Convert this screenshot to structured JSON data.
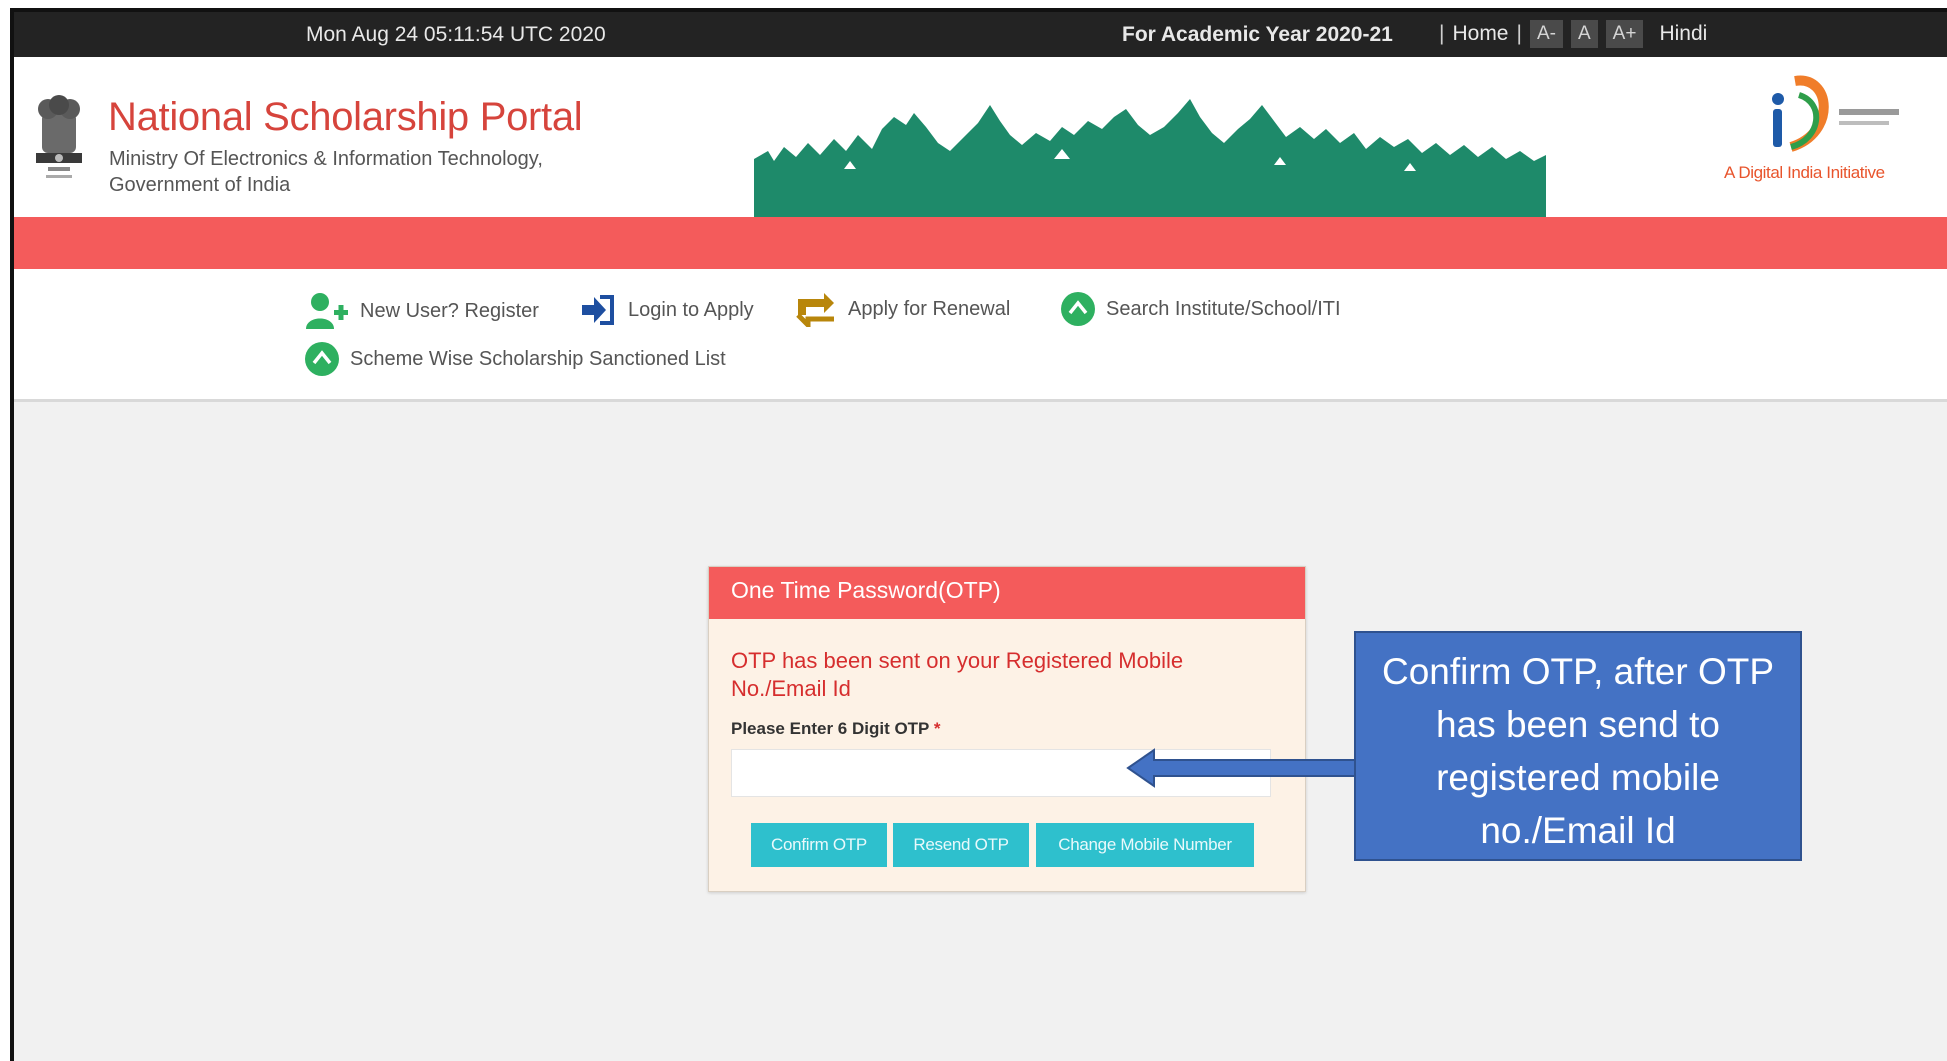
{
  "topbar": {
    "datetime": "Mon Aug 24 05:11:54 UTC 2020",
    "academic_year": "For Academic Year 2020-21",
    "sep": "|",
    "home": "Home",
    "font_small": "A-",
    "font_normal": "A",
    "font_large": "A+",
    "hindi": "Hindi"
  },
  "header": {
    "title": "National Scholarship Portal",
    "ministry": "Ministry Of Electronics & Information Technology,",
    "government": "Government of India",
    "digital_india_tagline": "A Digital India Initiative"
  },
  "nav": {
    "register": "New User? Register",
    "login": "Login to Apply",
    "renewal": "Apply for Renewal",
    "search": "Search Institute/School/ITI",
    "scheme_list": "Scheme Wise Scholarship Sanctioned List"
  },
  "otp_card": {
    "title": "One Time Password(OTP)",
    "message": "OTP has been sent on your Registered Mobile No./Email Id",
    "label": "Please Enter 6 Digit OTP",
    "required_mark": "*",
    "input_value": "",
    "confirm_label": "Confirm OTP",
    "resend_label": "Resend OTP",
    "change_label": "Change Mobile Number"
  },
  "annotation": {
    "line1": "Confirm OTP, after OTP",
    "line2": "has been send to",
    "line3": "registered mobile",
    "line4": "no./Email Id"
  },
  "colors": {
    "brand_red": "#f45b5b",
    "button_teal": "#2ec0cd",
    "callout_blue": "#4472c4",
    "banner_green": "#1e8a6a"
  }
}
